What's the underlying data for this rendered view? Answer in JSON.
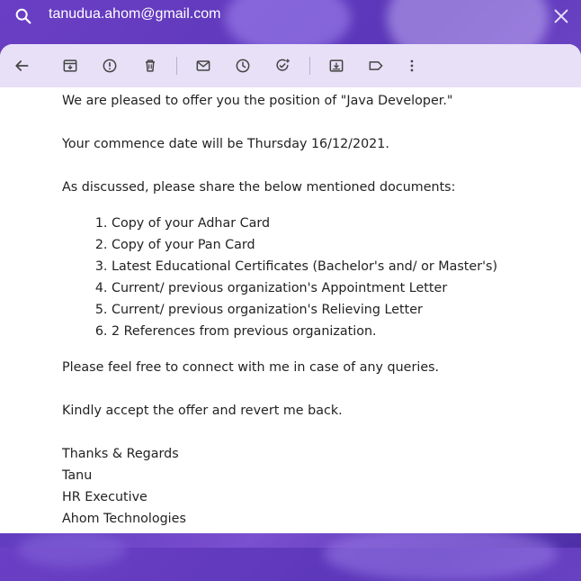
{
  "search": {
    "query": "tanudua.ahom@gmail.com",
    "search_icon": "search-icon",
    "close_icon": "close-icon"
  },
  "toolbar": {
    "icons": [
      "back-arrow-icon",
      "archive-icon",
      "report-spam-icon",
      "delete-icon",
      "mark-unread-icon",
      "snooze-icon",
      "add-task-icon",
      "move-to-icon",
      "label-icon",
      "more-vert-icon"
    ]
  },
  "email": {
    "line1": "We are pleased to offer you the position of  \"Java Developer.\"",
    "line2": "Your commence date will be Thursday 16/12/2021.",
    "line3": "As discussed, please share the below mentioned documents:",
    "documents": [
      "Copy of your Adhar Card",
      "Copy of your Pan Card",
      "Latest Educational Certificates (Bachelor's and/ or Master's)",
      "Current/ previous organization's Appointment Letter",
      "Current/ previous organization's Relieving Letter",
      "2 References from previous organization."
    ],
    "line4": "Please feel free to connect with me in case of any queries.",
    "line5": "Kindly accept the offer and revert me back.",
    "signature": {
      "closing": "Thanks & Regards",
      "name": "Tanu",
      "title": "HR Executive",
      "company": "Ahom Technologies"
    }
  }
}
